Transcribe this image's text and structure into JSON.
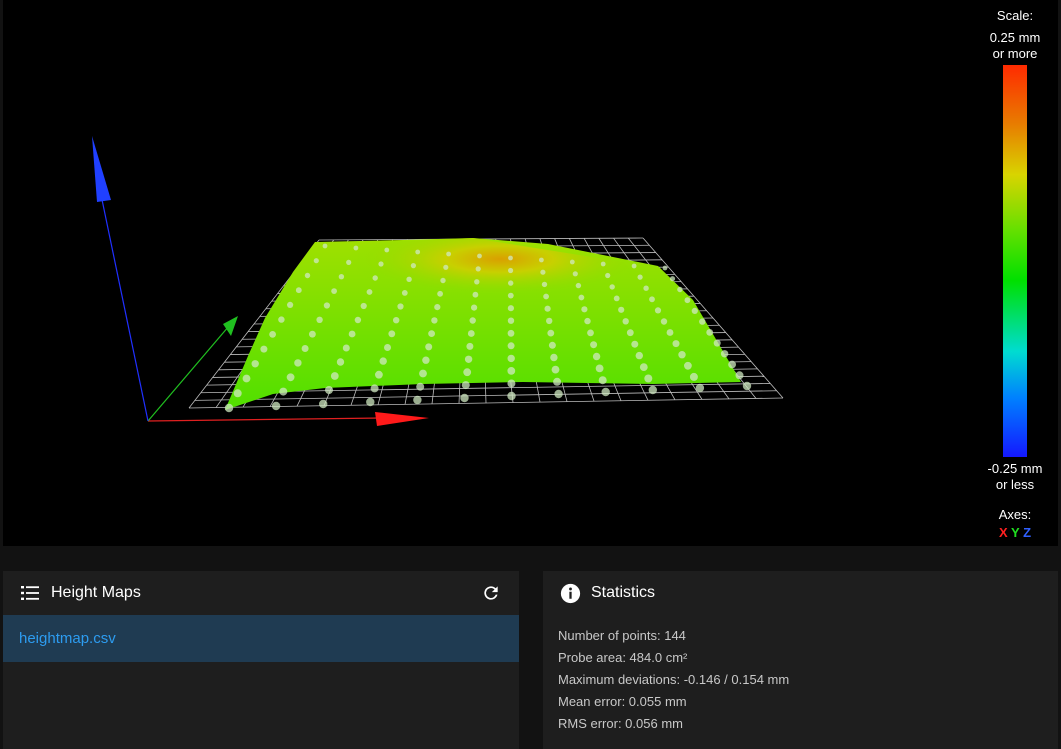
{
  "scale": {
    "title": "Scale:",
    "max_label_1": "0.25 mm",
    "max_label_2": "or more",
    "min_label_1": "-0.25 mm",
    "min_label_2": "or less"
  },
  "axes": {
    "title": "Axes:",
    "x": "X",
    "y": "Y",
    "z": "Z"
  },
  "colors": {
    "x_axis": "#ff2020",
    "y_axis": "#20e020",
    "z_axis": "#3060ff",
    "selected_row": "#1f3b52",
    "link": "#2d9cf0"
  },
  "heightmaps": {
    "title": "Height Maps",
    "icon": "list-icon",
    "refresh_icon": "refresh-icon",
    "files": [
      "heightmap.csv"
    ]
  },
  "statistics": {
    "title": "Statistics",
    "icon": "info-icon",
    "lines": [
      "Number of points: 144",
      "Probe area: 484.0 cm²",
      "Maximum deviations: -0.146 / 0.154 mm",
      "Mean error: 0.055 mm",
      "RMS error: 0.056 mm"
    ]
  }
}
